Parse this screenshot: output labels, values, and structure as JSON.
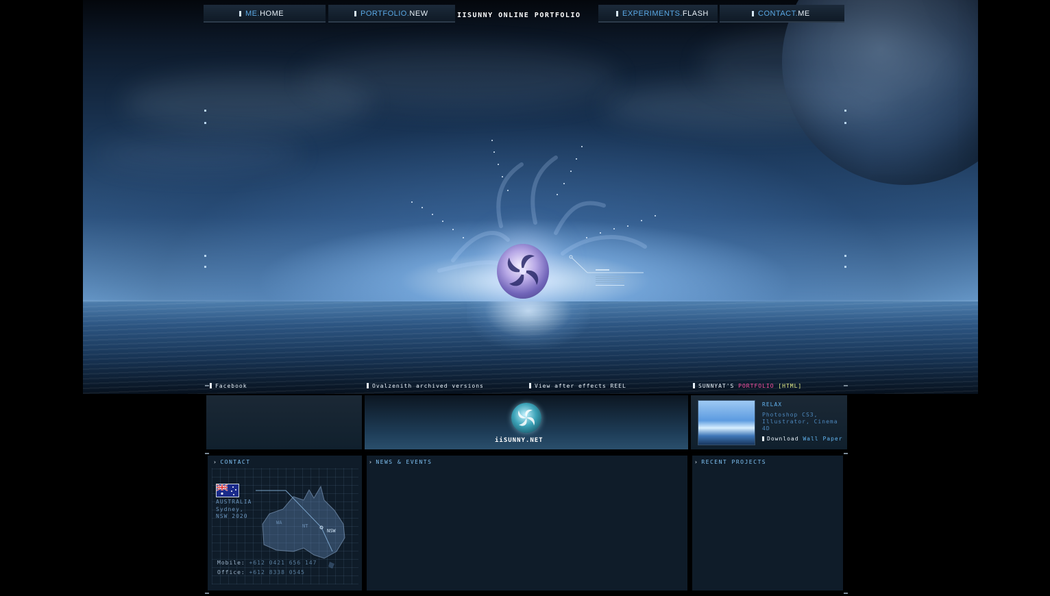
{
  "nav": {
    "items": [
      {
        "prefix": "ME.",
        "suffix": "HOME"
      },
      {
        "prefix": "PORTFOLIO.",
        "suffix": "NEW"
      },
      {
        "prefix": "EXPERIMENTS.",
        "suffix": "FLASH"
      },
      {
        "prefix": "CONTACT.",
        "suffix": "ME"
      }
    ],
    "title": "iiSUNNY ONLINE PORTFOLIO"
  },
  "strip": {
    "facebook_label": "Facebook",
    "archived_label": "Ovalzenith archived versions",
    "reel_label": "View after effects REEL",
    "promo_header": {
      "prefix": "SUNNYAT'S ",
      "highlight": "PORTFOLIO",
      "suffix": " [HTML]"
    },
    "logo_text": "iiSUNNY.NET",
    "promo": {
      "title": "RELAX",
      "desc": "Photoshop CS3, Illustrator, Cinema 4D",
      "download_prefix": "Download ",
      "download_link": "Wall Paper"
    }
  },
  "contact": {
    "header": "CONTACT",
    "country": "AUSTRALIA",
    "city": "Sydney,",
    "postcode": "NSW 2020",
    "state_labels": [
      "WA",
      "NT",
      "NSW"
    ],
    "mobile_label": "Mobile:",
    "mobile": "+612 0421 656 147",
    "office_label": "Office:",
    "office": "+612 8338 0545"
  },
  "news": {
    "header": "NEWS & EVENTS"
  },
  "projects": {
    "header": "RECENT PROJECTS"
  },
  "colors": {
    "accent_blue": "#5aa9e6",
    "highlight_pink": "#ff4fa3",
    "highlight_yellow": "#e6f08a",
    "panel_bg": "#0f1c29"
  }
}
